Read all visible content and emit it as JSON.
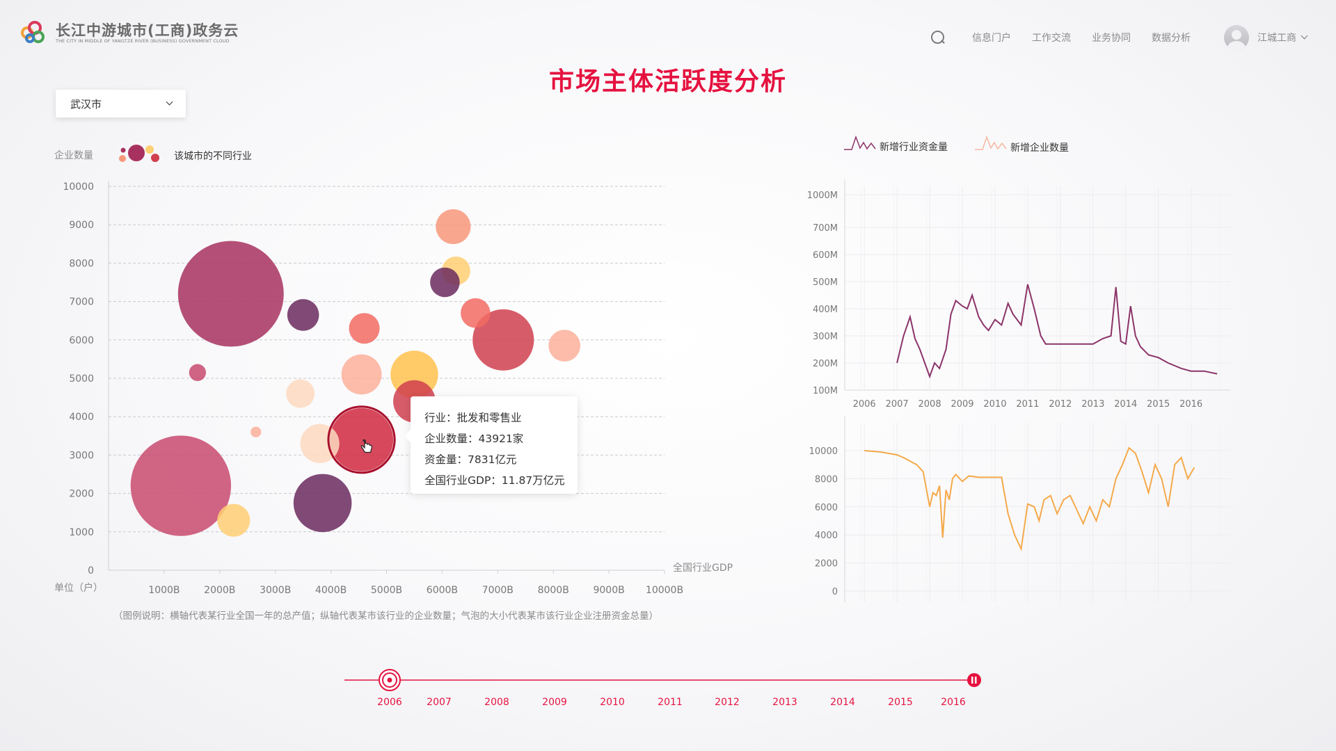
{
  "header": {
    "logo_title": "长江中游城市(工商)政务云",
    "logo_subtitle": "THE CITY IN MIDDLE OF YANGTZE RIVER (BUSINESS) GOVERNMENT CLOUD",
    "nav": [
      "信息门户",
      "工作交流",
      "业务协同",
      "数据分析"
    ],
    "user_name": "江城工商",
    "icons": [
      "search-icon",
      "avatar",
      "chevron-down-icon"
    ]
  },
  "page_title": "市场主体活跃度分析",
  "city_select": {
    "value": "武汉市"
  },
  "bubble_legend": "该城市的不同行业",
  "note": "（图例说明：横轴代表某行业全国一年的总产值；纵轴代表某市该行业的企业数量；气泡的大小代表某市该行业企业注册资金总量）",
  "tooltip": {
    "lines": [
      "行业：批发和零售业",
      "企业数量：43921家",
      "资金量：7831亿元",
      "全国行业GDP：11.87万亿元"
    ]
  },
  "timeline": {
    "years": [
      "2006",
      "2007",
      "2008",
      "2009",
      "2010",
      "2011",
      "2012",
      "2013",
      "2014",
      "2015",
      "2016"
    ],
    "current": "2006",
    "color": "#e5123f"
  },
  "chart_data": [
    {
      "type": "scatter",
      "title": "",
      "ylabel": "企业数量",
      "ylabel_unit": "单位（户）",
      "xlabel": "全国行业GDP",
      "xlim": [
        0,
        10000
      ],
      "ylim": [
        0,
        10000
      ],
      "x_ticks": [
        "1000B",
        "2000B",
        "3000B",
        "4000B",
        "5000B",
        "6000B",
        "7000B",
        "8000B",
        "9000B",
        "10000B"
      ],
      "y_ticks": [
        "0",
        "1000",
        "2000",
        "3000",
        "4000",
        "5000",
        "6000",
        "7000",
        "8000",
        "9000",
        "10000"
      ],
      "grid": true,
      "points": [
        {
          "x": 2200,
          "y": 7200,
          "size": 1.0,
          "color": "#a8325f"
        },
        {
          "x": 1300,
          "y": 2200,
          "size": 0.95,
          "color": "#c94a6f"
        },
        {
          "x": 3850,
          "y": 1750,
          "size": 0.55,
          "color": "#6b2a5e"
        },
        {
          "x": 4550,
          "y": 3400,
          "size": 0.6,
          "color": "#d0283f"
        },
        {
          "x": 7100,
          "y": 6000,
          "size": 0.58,
          "color": "#d0404f"
        },
        {
          "x": 3500,
          "y": 6650,
          "size": 0.3,
          "color": "#6b2a5e"
        },
        {
          "x": 4600,
          "y": 6300,
          "size": 0.29,
          "color": "#f26b63"
        },
        {
          "x": 5500,
          "y": 5100,
          "size": 0.45,
          "color": "#ffc24d"
        },
        {
          "x": 4550,
          "y": 5100,
          "size": 0.38,
          "color": "#fbb09a"
        },
        {
          "x": 5500,
          "y": 4400,
          "size": 0.4,
          "color": "#d0404f"
        },
        {
          "x": 3800,
          "y": 3300,
          "size": 0.37,
          "color": "#fdd9c0"
        },
        {
          "x": 3450,
          "y": 4600,
          "size": 0.27,
          "color": "#fdd9c0"
        },
        {
          "x": 6200,
          "y": 8950,
          "size": 0.33,
          "color": "#f7987a"
        },
        {
          "x": 6250,
          "y": 7800,
          "size": 0.27,
          "color": "#ffcf73"
        },
        {
          "x": 6050,
          "y": 7500,
          "size": 0.28,
          "color": "#6b2a5e"
        },
        {
          "x": 6600,
          "y": 6700,
          "size": 0.28,
          "color": "#f26b63"
        },
        {
          "x": 8200,
          "y": 5850,
          "size": 0.3,
          "color": "#fbb09a"
        },
        {
          "x": 2250,
          "y": 1300,
          "size": 0.31,
          "color": "#ffcf73"
        },
        {
          "x": 1600,
          "y": 5150,
          "size": 0.16,
          "color": "#c94a6f"
        },
        {
          "x": 2650,
          "y": 3600,
          "size": 0.1,
          "color": "#fbb09a"
        }
      ]
    },
    {
      "type": "line",
      "legend": "新增行业资金量",
      "x_ticks": [
        "2006",
        "2007",
        "2008",
        "2009",
        "2010",
        "2011",
        "2012",
        "2013",
        "2014",
        "2015",
        "2016"
      ],
      "y_ticks": [
        "100M",
        "200M",
        "300M",
        "400M",
        "500M",
        "600M",
        "700M",
        "1000M"
      ],
      "color": "#8b3368",
      "grid": true,
      "x": [
        2007.0,
        2007.2,
        2007.4,
        2007.55,
        2007.7,
        2007.85,
        2008.0,
        2008.15,
        2008.3,
        2008.5,
        2008.65,
        2008.8,
        2009.0,
        2009.15,
        2009.3,
        2009.5,
        2009.65,
        2009.8,
        2010.0,
        2010.2,
        2010.4,
        2010.55,
        2010.8,
        2011.0,
        2011.2,
        2011.4,
        2011.55,
        2011.8,
        2012.0,
        2012.2,
        2012.5,
        2013.0,
        2013.3,
        2013.55,
        2013.7,
        2013.85,
        2014.0,
        2014.15,
        2014.3,
        2014.45,
        2014.7,
        2015.0,
        2015.3,
        2015.7,
        2016.0,
        2016.4,
        2016.8
      ],
      "y": [
        200,
        300,
        370,
        290,
        250,
        200,
        150,
        200,
        180,
        250,
        380,
        430,
        410,
        400,
        450,
        370,
        340,
        320,
        360,
        340,
        420,
        380,
        340,
        490,
        400,
        300,
        270,
        270,
        270,
        270,
        270,
        270,
        290,
        300,
        480,
        280,
        270,
        410,
        300,
        260,
        230,
        220,
        200,
        180,
        170,
        170,
        160
      ]
    },
    {
      "type": "line",
      "legend": "新增企业数量",
      "x_ticks": [],
      "y_ticks": [
        "0",
        "2000",
        "4000",
        "6000",
        "8000",
        "10000"
      ],
      "color": "#f5a94a",
      "grid": true,
      "x": [
        2006.0,
        2006.5,
        2007.0,
        2007.2,
        2007.6,
        2007.8,
        2008.0,
        2008.1,
        2008.2,
        2008.3,
        2008.4,
        2008.5,
        2008.6,
        2008.7,
        2008.8,
        2009.0,
        2009.2,
        2009.5,
        2010.0,
        2010.2,
        2010.4,
        2010.6,
        2010.8,
        2011.0,
        2011.2,
        2011.35,
        2011.5,
        2011.7,
        2011.9,
        2012.1,
        2012.3,
        2012.5,
        2012.7,
        2012.9,
        2013.1,
        2013.3,
        2013.5,
        2013.7,
        2013.9,
        2014.1,
        2014.3,
        2014.5,
        2014.7,
        2014.9,
        2015.1,
        2015.3,
        2015.5,
        2015.7,
        2015.9,
        2016.1
      ],
      "y": [
        10000,
        9900,
        9700,
        9500,
        9000,
        8500,
        6000,
        7000,
        6800,
        7500,
        3800,
        7200,
        6500,
        8000,
        8300,
        7800,
        8200,
        8100,
        8100,
        8100,
        5500,
        4000,
        3000,
        6200,
        6000,
        5000,
        6500,
        6800,
        5500,
        6500,
        6800,
        5800,
        4800,
        6000,
        5000,
        6500,
        6000,
        8000,
        9000,
        10200,
        9800,
        8500,
        7000,
        9000,
        8000,
        6000,
        9000,
        9500,
        8000,
        8800
      ]
    }
  ],
  "colors": {
    "accent": "#e5123f",
    "bubble_palette": [
      "#a8325f",
      "#c94a6f",
      "#6b2a5e",
      "#d0283f",
      "#f26b63",
      "#fbb09a",
      "#ffc24d",
      "#fdd9c0"
    ]
  }
}
